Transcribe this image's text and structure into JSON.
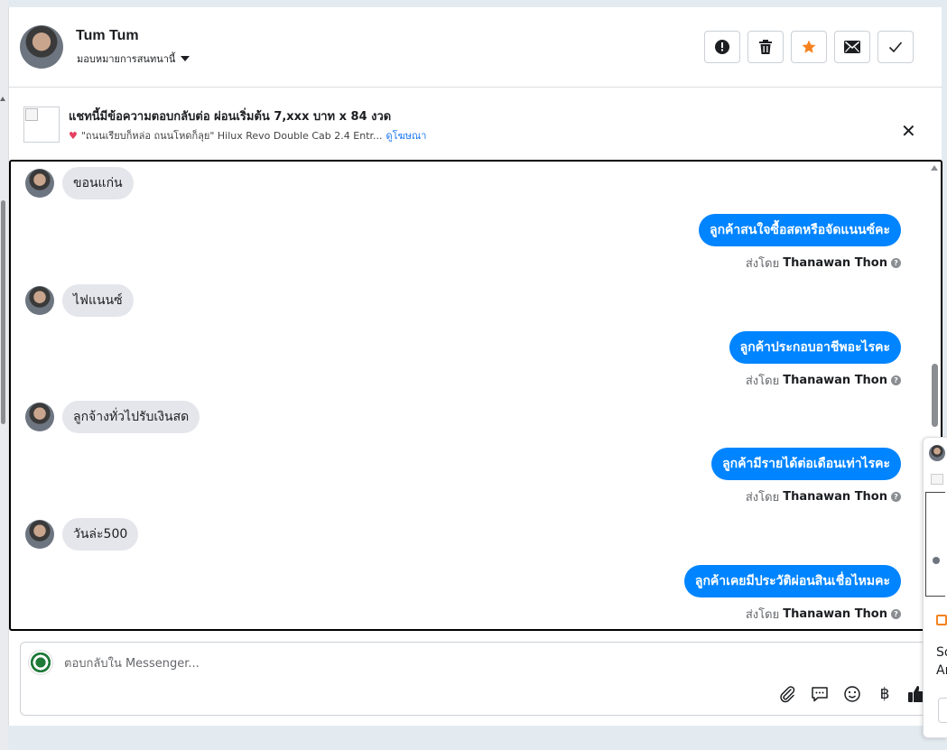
{
  "header": {
    "user_name": "Tum Tum",
    "assign_label": "มอบหมายการสนทนานี้",
    "actions": [
      "spam",
      "delete",
      "star",
      "mark-unread",
      "done"
    ]
  },
  "ad": {
    "title": "แชทนี้มีข้อความตอบกลับต่อ ผ่อนเริ่มต้น 7,xxx บาท x 84 งวด",
    "subtitle": "\"ถนนเรียบก็หล่อ ถนนโหดก็ลุย\"  Hilux Revo Double Cab 2.4 Entr...",
    "link": "ดูโฆษณา"
  },
  "chat": {
    "sent_by_prefix": "ส่งโดย",
    "messages": [
      {
        "dir": "in",
        "text": "ขอนแก่น"
      },
      {
        "dir": "out",
        "text": "ลูกค้าสนใจซื้อสดหรือจัดแนนซ์คะ",
        "sender": "Thanawan Thon"
      },
      {
        "dir": "in",
        "text": "ไฟแนนซ์"
      },
      {
        "dir": "out",
        "text": "ลูกค้าประกอบอาชีพอะไรคะ",
        "sender": "Thanawan Thon"
      },
      {
        "dir": "in",
        "text": "ลูกจ้างทั่วไปรับเงินสด"
      },
      {
        "dir": "out",
        "text": "ลูกค้ามีรายได้ต่อเดือนเท่าไรคะ",
        "sender": "Thanawan Thon"
      },
      {
        "dir": "in",
        "text": "วันล่ะ500"
      },
      {
        "dir": "out",
        "text": "ลูกค้าเคยมีประวัติผ่อนสินเชื่อไหมคะ",
        "sender": "Thanawan Thon"
      }
    ]
  },
  "composer": {
    "placeholder": "ตอบกลับใน Messenger..."
  },
  "peek": {
    "line1": "So",
    "line2": "Ar"
  },
  "colors": {
    "accent": "#0084ff",
    "bubble_in": "#e4e6eb",
    "star": "#f5821f"
  }
}
